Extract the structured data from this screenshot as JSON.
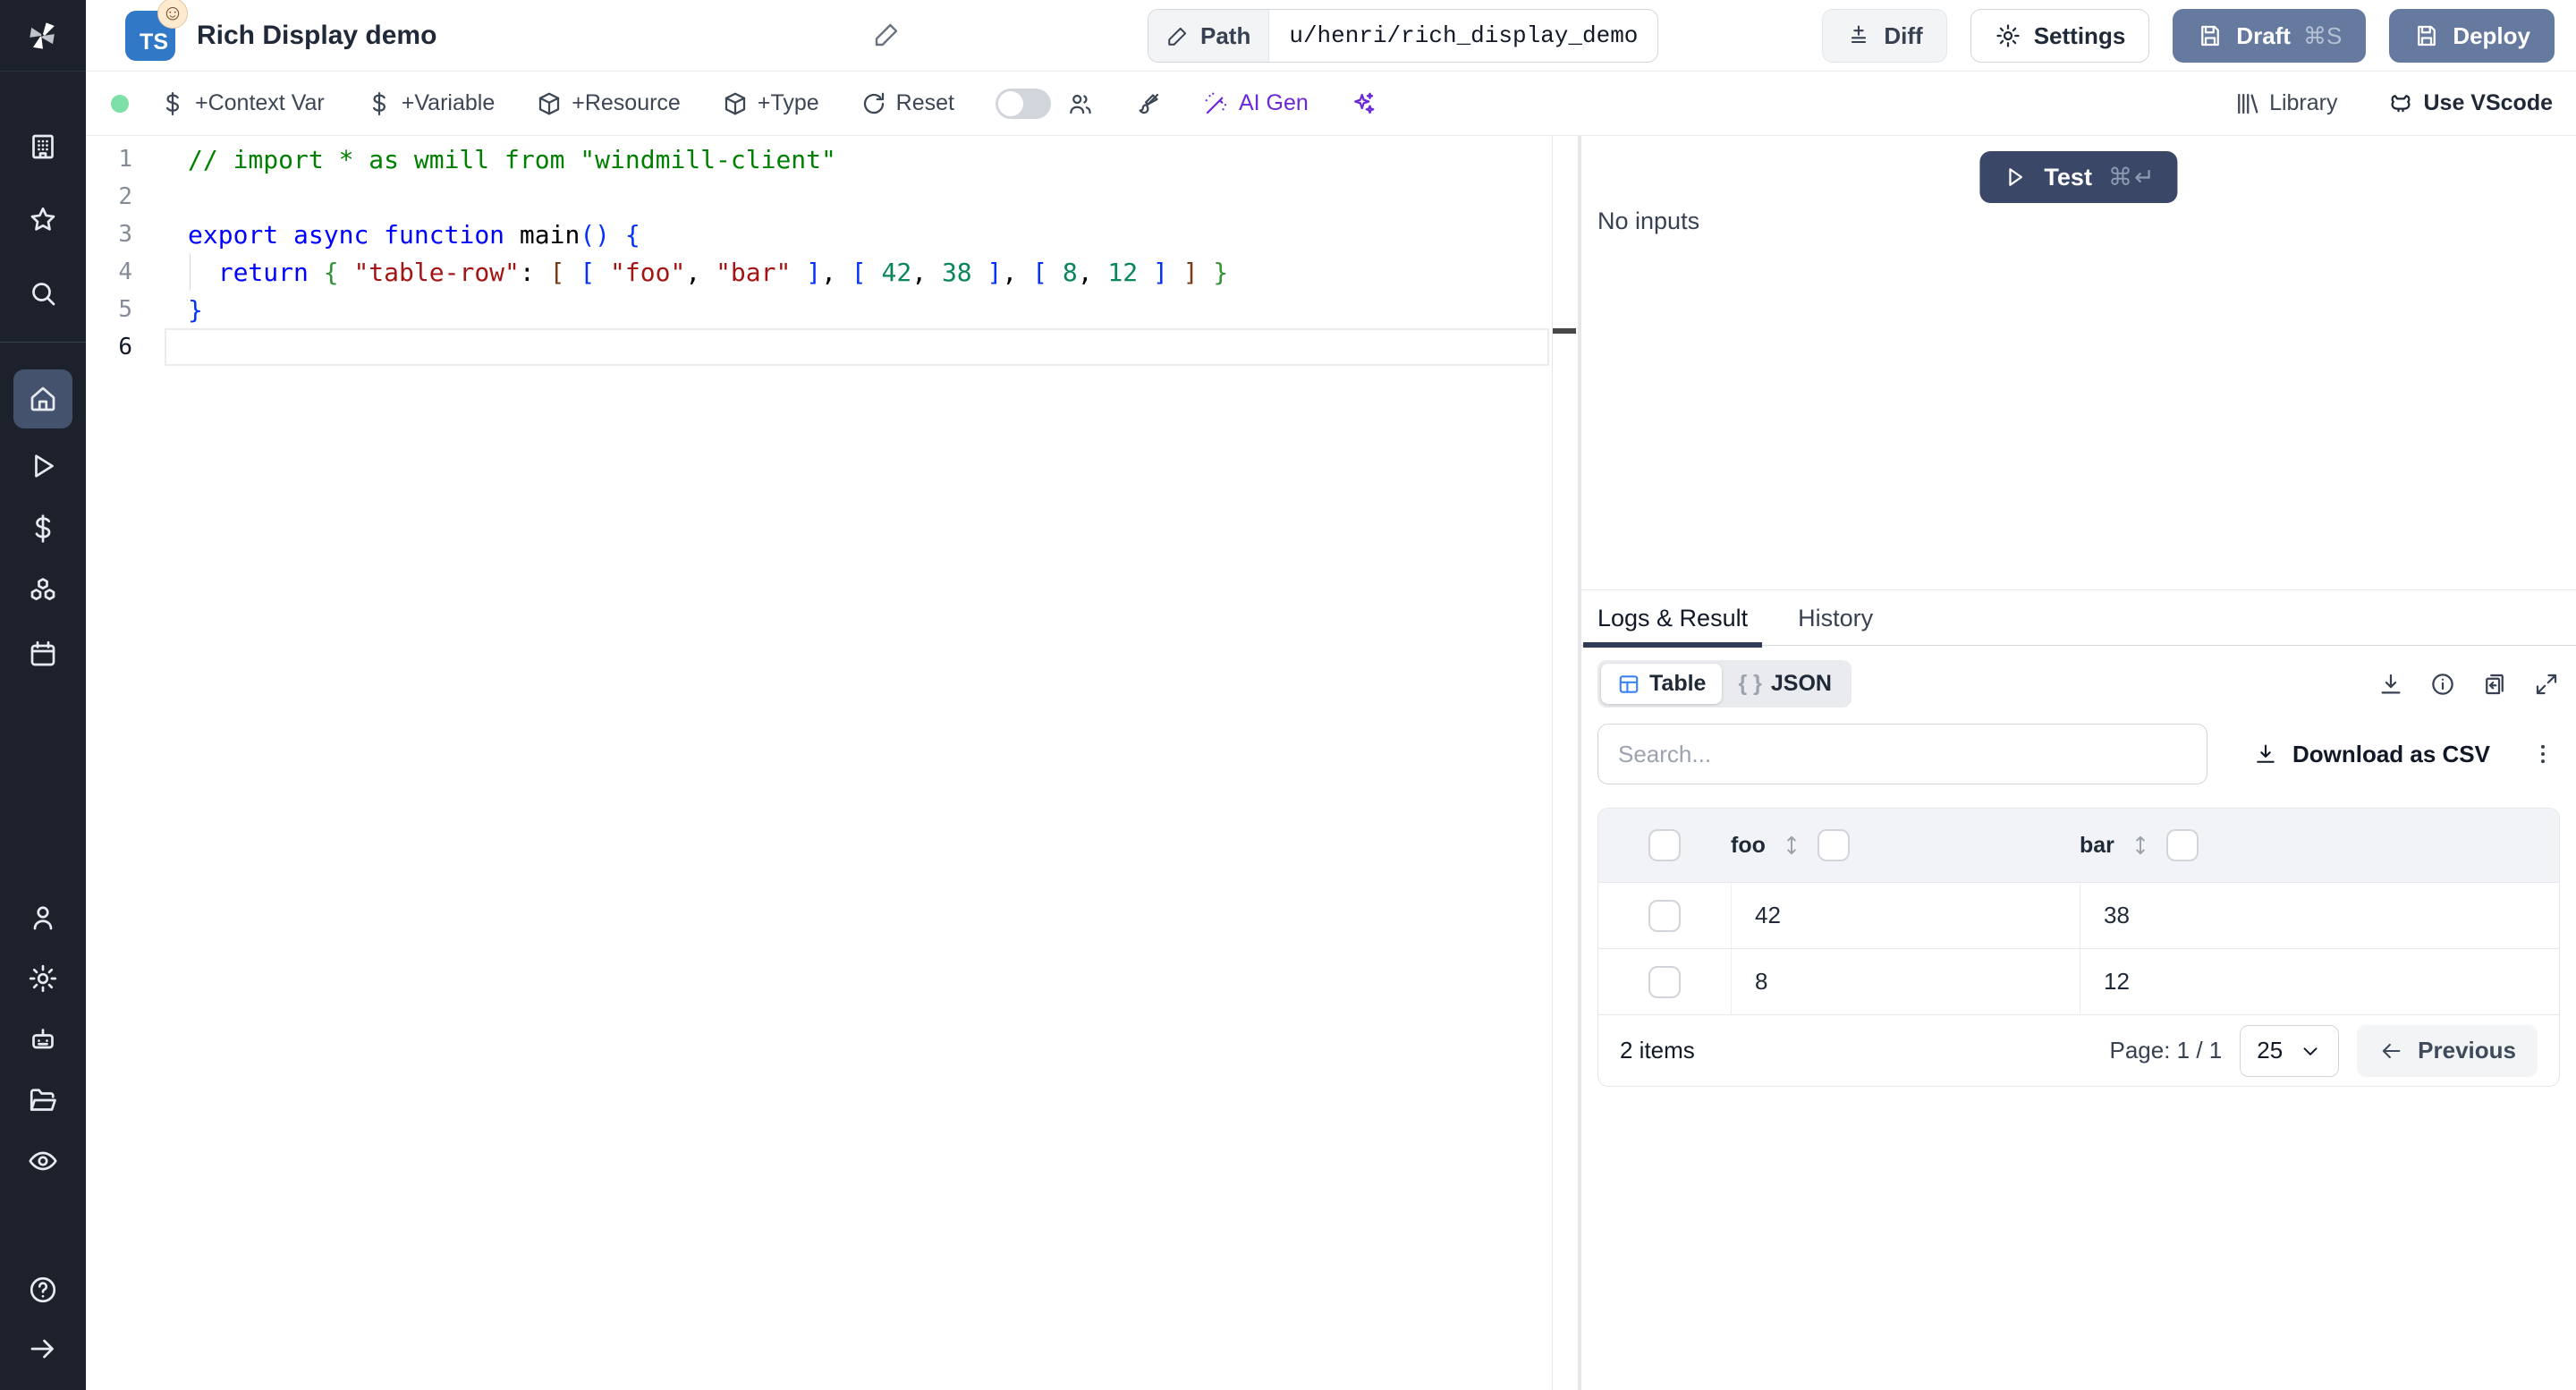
{
  "app": {
    "title": "Rich Display demo",
    "language_badge": "TS"
  },
  "header": {
    "path_label": "Path",
    "path_value": "u/henri/rich_display_demo",
    "diff_label": "Diff",
    "settings_label": "Settings",
    "draft_label": "Draft",
    "draft_shortcut": "⌘S",
    "deploy_label": "Deploy"
  },
  "toolbar": {
    "context_var_label": "+Context Var",
    "variable_label": "+Variable",
    "resource_label": "+Resource",
    "type_label": "+Type",
    "reset_label": "Reset",
    "ai_gen_label": "AI Gen",
    "library_label": "Library",
    "use_vscode_label": "Use VScode"
  },
  "editor": {
    "lines": [
      {
        "n": "1",
        "tokens": [
          [
            "cm",
            "// import * as wmill from \"windmill-client\""
          ]
        ]
      },
      {
        "n": "2",
        "tokens": []
      },
      {
        "n": "3",
        "tokens": [
          [
            "kw",
            "export"
          ],
          [
            "pl",
            " "
          ],
          [
            "kw",
            "async"
          ],
          [
            "pl",
            " "
          ],
          [
            "kw",
            "function"
          ],
          [
            "pl",
            " "
          ],
          [
            "fn",
            "main"
          ],
          [
            "b1",
            "()"
          ],
          [
            "pl",
            " "
          ],
          [
            "b1",
            "{"
          ]
        ]
      },
      {
        "n": "4",
        "tokens": [
          [
            "pl",
            "  "
          ],
          [
            "kw",
            "return"
          ],
          [
            "pl",
            " "
          ],
          [
            "b2",
            "{"
          ],
          [
            "pl",
            " "
          ],
          [
            "st",
            "\"table-row\""
          ],
          [
            "pl",
            ": "
          ],
          [
            "b3",
            "["
          ],
          [
            "pl",
            " "
          ],
          [
            "b1",
            "["
          ],
          [
            "pl",
            " "
          ],
          [
            "st",
            "\"foo\""
          ],
          [
            "pl",
            ", "
          ],
          [
            "st",
            "\"bar\""
          ],
          [
            "pl",
            " "
          ],
          [
            "b1",
            "]"
          ],
          [
            "pl",
            ", "
          ],
          [
            "b1",
            "["
          ],
          [
            "pl",
            " "
          ],
          [
            "nm",
            "42"
          ],
          [
            "pl",
            ", "
          ],
          [
            "nm",
            "38"
          ],
          [
            "pl",
            " "
          ],
          [
            "b1",
            "]"
          ],
          [
            "pl",
            ", "
          ],
          [
            "b1",
            "["
          ],
          [
            "pl",
            " "
          ],
          [
            "nm",
            "8"
          ],
          [
            "pl",
            ", "
          ],
          [
            "nm",
            "12"
          ],
          [
            "pl",
            " "
          ],
          [
            "b1",
            "]"
          ],
          [
            "pl",
            " "
          ],
          [
            "b3",
            "]"
          ],
          [
            "pl",
            " "
          ],
          [
            "b2",
            "}"
          ]
        ]
      },
      {
        "n": "5",
        "tokens": [
          [
            "b1",
            "}"
          ]
        ]
      },
      {
        "n": "6",
        "tokens": [],
        "current": true
      }
    ]
  },
  "run_panel": {
    "test_label": "Test",
    "test_shortcut": "⌘↵",
    "no_inputs_label": "No inputs"
  },
  "result_panel": {
    "tabs": [
      {
        "label": "Logs & Result"
      },
      {
        "label": "History"
      }
    ],
    "view_toggle": [
      {
        "label": "Table"
      },
      {
        "label": "JSON"
      }
    ],
    "search_placeholder": "Search...",
    "download_csv_label": "Download as CSV",
    "table": {
      "columns": [
        "foo",
        "bar"
      ],
      "rows": [
        [
          "42",
          "38"
        ],
        [
          "8",
          "12"
        ]
      ],
      "items_label": "2 items",
      "page_label": "Page: 1 / 1",
      "page_size": "25",
      "previous_label": "Previous"
    }
  },
  "colors": {
    "sidebar_bg": "#1d212b",
    "sidebar_active": "#44526d",
    "primary_button": "#3a4767",
    "secondary_button": "#66799e",
    "accent_purple": "#6d28d9",
    "status_green": "#7fe0a7",
    "ts_badge_blue": "#3178c6",
    "table_icon_blue": "#3b82f6"
  }
}
